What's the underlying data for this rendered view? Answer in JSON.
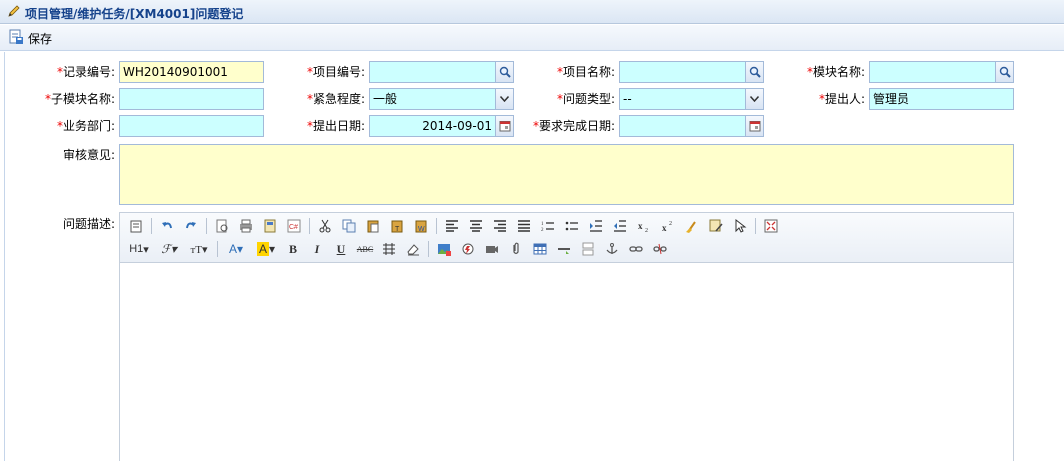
{
  "title": "项目管理/维护任务/[XM4001]问题登记",
  "toolbar": {
    "save_label": "保存"
  },
  "form": {
    "record_no": {
      "label": "记录编号:",
      "value": "WH20140901001"
    },
    "project_no": {
      "label": "项目编号:",
      "value": ""
    },
    "project_name": {
      "label": "项目名称:",
      "value": ""
    },
    "module_name": {
      "label": "模块名称:",
      "value": ""
    },
    "submodule_name": {
      "label": "子模块名称:",
      "value": ""
    },
    "urgency": {
      "label": "紧急程度:",
      "value": "一般"
    },
    "issue_type": {
      "label": "问题类型:",
      "value": "--"
    },
    "submitter": {
      "label": "提出人:",
      "value": "管理员"
    },
    "department": {
      "label": "业务部门:",
      "value": ""
    },
    "submit_date": {
      "label": "提出日期:",
      "value": "2014-09-01"
    },
    "due_date": {
      "label": "要求完成日期:",
      "value": ""
    },
    "review": {
      "label": "审核意见:"
    },
    "description": {
      "label": "问题描述:"
    }
  },
  "required_mark": "*",
  "editor": {
    "row1": [
      "source",
      "undo",
      "redo",
      "preview",
      "print",
      "template",
      "code",
      "cut",
      "copy",
      "paste",
      "paste-text",
      "paste-word",
      "align-left",
      "align-center",
      "align-right",
      "align-justify",
      "ordered-list",
      "unordered-list",
      "indent",
      "outdent",
      "subscript",
      "superscript",
      "clear-format",
      "select-all",
      "select",
      "fullscreen"
    ],
    "heading_label": "H1",
    "bold_label": "B",
    "italic_label": "I",
    "underline_label": "U",
    "strike_label": "ABC"
  }
}
